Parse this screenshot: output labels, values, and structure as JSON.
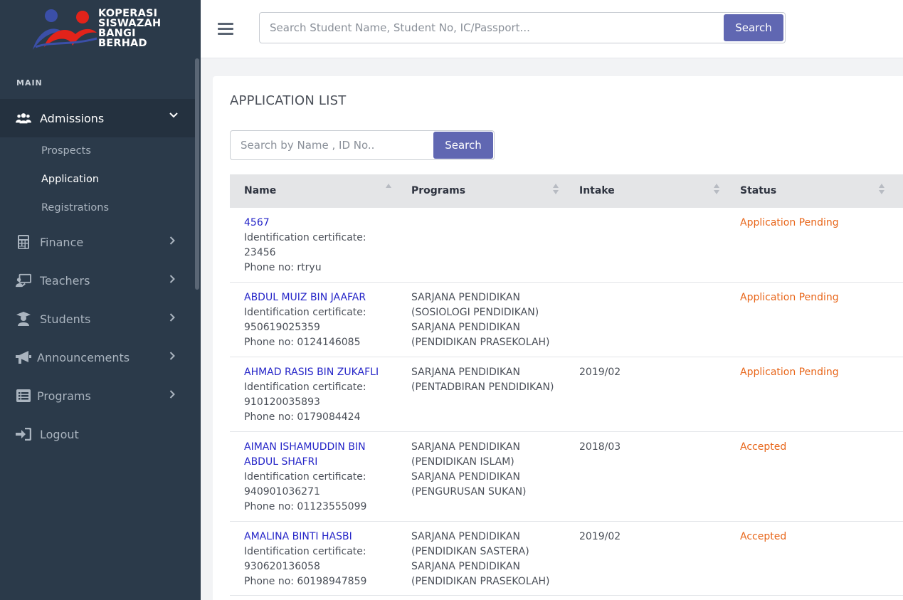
{
  "brand": {
    "lines": [
      "KOPERASI",
      "SISWAZAH",
      "BANGI",
      "BERHAD"
    ]
  },
  "sidebar": {
    "section_label": "MAIN",
    "items": [
      {
        "label": "Admissions",
        "icon": "users-icon",
        "chevron": "⌄"
      },
      {
        "label": "Finance",
        "icon": "calculator-icon",
        "chevron": "›"
      },
      {
        "label": "Teachers",
        "icon": "teacher-board-icon",
        "chevron": "›"
      },
      {
        "label": "Students",
        "icon": "graduate-icon",
        "chevron": "›"
      },
      {
        "label": "Announcements",
        "icon": "megaphone-icon",
        "chevron": "›"
      },
      {
        "label": "Programs",
        "icon": "list-icon",
        "chevron": "›"
      },
      {
        "label": "Logout",
        "icon": "sign-in-icon"
      }
    ],
    "subitems": [
      "Prospects",
      "Application",
      "Registrations"
    ]
  },
  "topbar": {
    "search_placeholder": "Search Student Name, Student No, IC/Passport...",
    "search_button": "Search"
  },
  "main": {
    "title": "APPLICATION LIST",
    "search_placeholder": "Search by Name , ID No..",
    "search_button": "Search",
    "columns": [
      "Name",
      "Programs",
      "Intake",
      "Status"
    ],
    "rows": [
      {
        "name": "4567",
        "ic": "Identification certificate:",
        "ic_no": "23456",
        "phone": "Phone no: rtryu",
        "programs": [],
        "intake": "",
        "status": "Application Pending"
      },
      {
        "name": "ABDUL MUIZ BIN JAAFAR",
        "ic": "Identification certificate:",
        "ic_no": "950619025359",
        "phone": "Phone no: 0124146085",
        "programs": [
          "SARJANA PENDIDIKAN",
          "(SOSIOLOGI PENDIDIKAN)",
          "SARJANA PENDIDIKAN",
          "(PENDIDIKAN PRASEKOLAH)"
        ],
        "intake": "",
        "status": "Application Pending"
      },
      {
        "name": "AHMAD RASIS BIN ZUKAFLI",
        "ic": "Identification certificate:",
        "ic_no": "910120035893",
        "phone": "Phone no: 0179084424",
        "programs": [
          "SARJANA PENDIDIKAN",
          "(PENTADBIRAN PENDIDIKAN)"
        ],
        "intake": "2019/02",
        "status": "Application Pending"
      },
      {
        "name": "AIMAN ISHAMUDDIN BIN",
        "name2": "ABDUL SHAFRI",
        "ic": "Identification certificate:",
        "ic_no": "940901036271",
        "phone": "Phone no: 01123555099",
        "programs": [
          "SARJANA PENDIDIKAN",
          "(PENDIDIKAN ISLAM)",
          "SARJANA PENDIDIKAN",
          "(PENGURUSAN SUKAN)"
        ],
        "intake": "2018/03",
        "status": "Accepted"
      },
      {
        "name": "AMALINA BINTI HASBI",
        "ic": "Identification certificate:",
        "ic_no": "930620136058",
        "phone": "Phone no: 60198947859",
        "programs": [
          "SARJANA PENDIDIKAN",
          "(PENDIDIKAN SASTERA)",
          "SARJANA PENDIDIKAN",
          "(PENDIDIKAN PRASEKOLAH)"
        ],
        "intake": "2019/02",
        "status": "Accepted"
      }
    ]
  }
}
